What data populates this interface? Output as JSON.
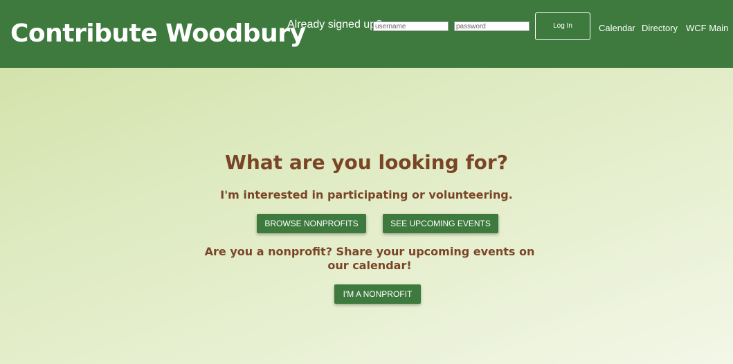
{
  "header": {
    "site_title": "Contribute Woodbury",
    "signin_label": "Already signed up?",
    "username_placeholder": "username",
    "password_placeholder": "password",
    "login_label": "Log In",
    "nav": [
      {
        "label": "Calendar"
      },
      {
        "label": "Directory"
      },
      {
        "label": "WCF Main"
      }
    ],
    "background_color": "#3e7a3e"
  },
  "main": {
    "heading": "What are you looking for?",
    "participate_text": "I'm interested in participating or volunteering.",
    "browse_button": "BROWSE NONPROFITS",
    "events_button": "SEE UPCOMING EVENTS",
    "nonprofit_text": "Are you a nonprofit? Share your upcoming events on our calendar!",
    "nonprofit_button": "I'M A NONPROFIT",
    "text_color": "#7a4526",
    "button_color": "#3e7a3e"
  }
}
